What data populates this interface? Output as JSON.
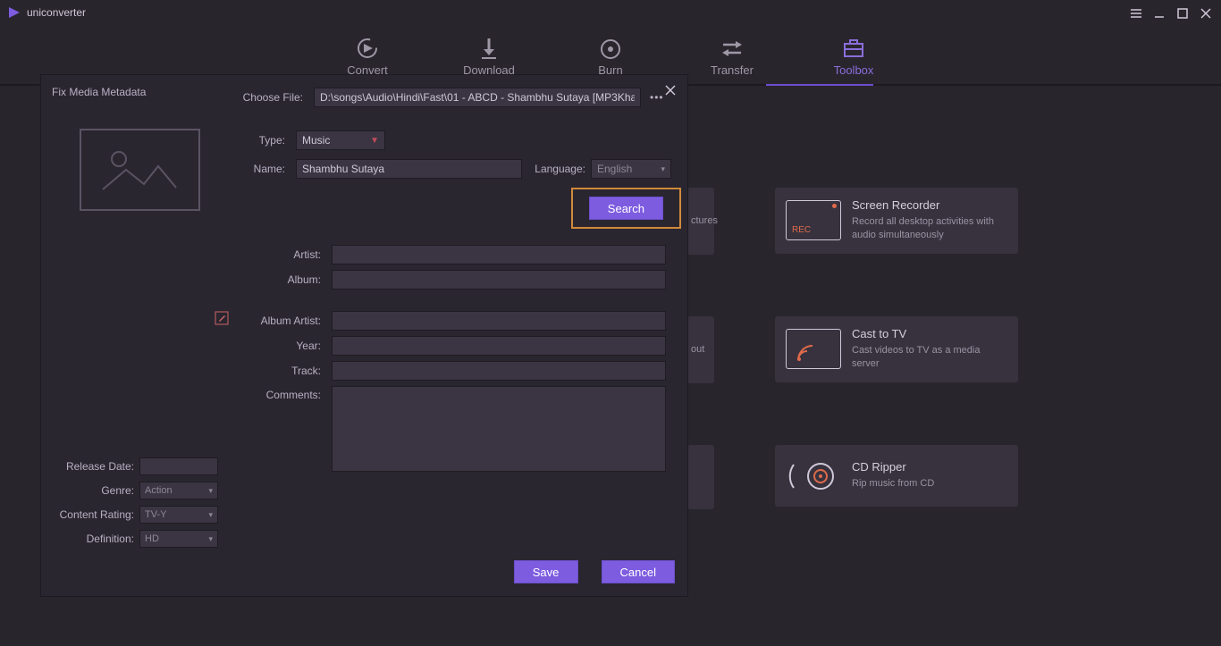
{
  "app": {
    "title": "uniconverter"
  },
  "tabs": [
    {
      "label": "Convert"
    },
    {
      "label": "Download"
    },
    {
      "label": "Burn"
    },
    {
      "label": "Transfer"
    },
    {
      "label": "Toolbox"
    }
  ],
  "toolbox": {
    "screen_recorder": {
      "title": "Screen Recorder",
      "desc": "Record all desktop activities with audio simultaneously",
      "badge": "REC"
    },
    "cast_tv": {
      "title": "Cast to TV",
      "desc": "Cast videos to TV as a media server"
    },
    "cd_ripper": {
      "title": "CD Ripper",
      "desc": "Rip music from CD"
    },
    "partial1": {
      "desc": "ctures"
    },
    "partial2": {
      "desc": "out"
    }
  },
  "modal": {
    "title": "Fix Media Metadata",
    "choose_file_label": "Choose File:",
    "file_path": "D:\\songs\\Audio\\Hindi\\Fast\\01 - ABCD - Shambhu Sutaya [MP3Kha",
    "type_label": "Type:",
    "type_value": "Music",
    "name_label": "Name:",
    "name_value": "Shambhu Sutaya",
    "language_label": "Language:",
    "language_value": "English",
    "search": "Search",
    "artist_label": "Artist:",
    "artist_value": "",
    "album_label": "Album:",
    "album_value": "",
    "album_artist_label": "Album Artist:",
    "album_artist_value": "",
    "year_label": "Year:",
    "year_value": "",
    "track_label": "Track:",
    "track_value": "",
    "comments_label": "Comments:",
    "comments_value": "",
    "release_date_label": "Release Date:",
    "release_date_value": "",
    "genre_label": "Genre:",
    "genre_value": "Action",
    "content_rating_label": "Content Rating:",
    "content_rating_value": "TV-Y",
    "definition_label": "Definition:",
    "definition_value": "HD",
    "save": "Save",
    "cancel": "Cancel"
  }
}
